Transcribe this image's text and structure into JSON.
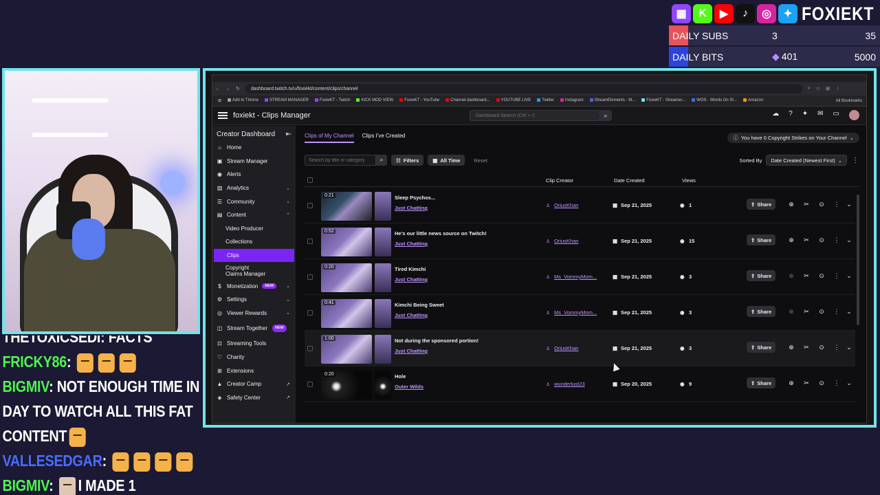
{
  "overlay": {
    "channel_brand": "FOXIEKT",
    "socials": [
      {
        "icon": "twitch-icon",
        "glyph": "▦",
        "color": "#9146ff"
      },
      {
        "icon": "kick-icon",
        "glyph": "K",
        "color": "#53fc18"
      },
      {
        "icon": "youtube-icon",
        "glyph": "▶",
        "color": "#ff0000"
      },
      {
        "icon": "tiktok-icon",
        "glyph": "♪",
        "color": "#111111"
      },
      {
        "icon": "instagram-icon",
        "glyph": "◎",
        "color": "#d6249f"
      },
      {
        "icon": "twitter-icon",
        "glyph": "✦",
        "color": "#1da1f2"
      }
    ],
    "goals": [
      {
        "label": "DAILY SUBS",
        "current": "3",
        "max": "35",
        "progress": 0.086,
        "color": "#e8525a"
      },
      {
        "label": "DAILY BITS",
        "current": "401",
        "max": "5000",
        "progress": 0.08,
        "color": "#2c44d9"
      }
    ]
  },
  "chat": [
    {
      "user": "THETOXICSEDI",
      "text": "FACTS",
      "color": "#ffffff",
      "emotes": 0,
      "cut": true
    },
    {
      "user": "FRICKY86",
      "text": "",
      "color": "#4ff24f",
      "emotes": 3
    },
    {
      "user": "BIGMIV",
      "text": "NOT ENOUGH TIME IN THE",
      "color": "#4ff24f",
      "emotes": 0
    },
    {
      "user": "",
      "text": "DAY TO WATCH ALL THIS FAT",
      "color": "#ffffff",
      "emotes": 0
    },
    {
      "user": "",
      "text": "CONTENT",
      "color": "#ffffff",
      "emotes": 1
    },
    {
      "user": "VALLESEDGAR",
      "text": "",
      "color": "#4a6cff",
      "emotes": 4
    },
    {
      "user": "BIGMIV",
      "text": "I MADE 1",
      "color": "#4ff24f",
      "emotes": 0,
      "face": true
    }
  ],
  "browser": {
    "url": "dashboard.twitch.tv/u/foxiekt/content/clips/channel",
    "bookmarks": [
      {
        "label": "Add to Throne",
        "color": "#a0a0a0"
      },
      {
        "label": "STREAM MANAGER",
        "color": "#9146ff"
      },
      {
        "label": "FoxieKT - Twitch",
        "color": "#9146ff"
      },
      {
        "label": "KICK MOD VIEW",
        "color": "#53fc18"
      },
      {
        "label": "FoxieKT - YouTube",
        "color": "#ff0000"
      },
      {
        "label": "Channel dashboard...",
        "color": "#ff0000"
      },
      {
        "label": "YOUTUBE LIVE",
        "color": "#ff0000"
      },
      {
        "label": "Twitter",
        "color": "#1da1f2"
      },
      {
        "label": "Instagram",
        "color": "#d6249f"
      },
      {
        "label": "StreamElements - M...",
        "color": "#4e5ff0"
      },
      {
        "label": "FoxieKT - Streamer...",
        "color": "#70e4e8"
      },
      {
        "label": "WOS - Words On St...",
        "color": "#3a6cf0"
      },
      {
        "label": "Amazon",
        "color": "#ff9900"
      }
    ],
    "all_bookmarks": "All Bookmarks"
  },
  "dashboard": {
    "page_title": "foxiekt - Clips Manager",
    "search_placeholder": "Dashboard Search (Ctrl + /)",
    "sidebar_title": "Creator Dashboard",
    "sidebar": [
      {
        "label": "Home",
        "icon": "home-icon",
        "glyph": "⌂"
      },
      {
        "label": "Stream Manager",
        "icon": "stream-manager-icon",
        "glyph": "▣"
      },
      {
        "label": "Alerts",
        "icon": "alerts-icon",
        "glyph": "◉"
      },
      {
        "label": "Analytics",
        "icon": "analytics-icon",
        "glyph": "▥",
        "chevron": "⌄"
      },
      {
        "label": "Community",
        "icon": "community-icon",
        "glyph": "☰",
        "chevron": "⌄"
      },
      {
        "label": "Content",
        "icon": "content-icon",
        "glyph": "▤",
        "chevron": "⌃"
      },
      {
        "label": "Video Producer",
        "sub": true
      },
      {
        "label": "Collections",
        "sub": true
      },
      {
        "label": "Clips",
        "sub": true,
        "active": true
      },
      {
        "label": "Copyright Claims Manager",
        "sub": true,
        "two": true
      },
      {
        "label": "Monetization",
        "icon": "monetization-icon",
        "glyph": "$",
        "chevron": "⌄",
        "badge": "NEW"
      },
      {
        "label": "Settings",
        "icon": "settings-icon",
        "glyph": "⚙",
        "chevron": "⌄"
      },
      {
        "label": "Viewer Rewards",
        "icon": "viewer-rewards-icon",
        "glyph": "◎",
        "chevron": "⌄"
      },
      {
        "label": "Stream Together",
        "icon": "stream-together-icon",
        "glyph": "◫",
        "two": true,
        "badge": "NEW"
      },
      {
        "label": "Streaming Tools",
        "icon": "streaming-tools-icon",
        "glyph": "⊡"
      },
      {
        "label": "Charity",
        "icon": "charity-icon",
        "glyph": "♡"
      },
      {
        "label": "Extensions",
        "icon": "extensions-icon",
        "glyph": "⊞"
      },
      {
        "label": "Creator Camp",
        "icon": "creator-camp-icon",
        "glyph": "▲",
        "ext": "↗"
      },
      {
        "label": "Safety Center",
        "icon": "safety-center-icon",
        "glyph": "◈",
        "ext": "↗"
      }
    ],
    "tabs": [
      "Clips of My Channel",
      "Clips I've Created"
    ],
    "strikes": "You have 0 Copyright Strikes on Your Channel",
    "clip_search_placeholder": "Search by title or category",
    "filters_label": "Filters",
    "all_time_label": "All Time",
    "reset_label": "Reset",
    "sorted_by_label": "Sorted By",
    "sort_value": "Date Created (Newest First)",
    "columns": {
      "creator": "Clip Creator",
      "date": "Date Created",
      "views": "Views"
    },
    "share_label": "Share",
    "clips": [
      {
        "duration": "0:21",
        "title": "Sleep Psychos...",
        "category": "Just Chatting",
        "creator": "OriusKhan",
        "date": "Sep 21, 2025",
        "views": "1",
        "thumb": "screen"
      },
      {
        "duration": "0:52",
        "title": "He's our little news source on Twitch!",
        "category": "Just Chatting",
        "creator": "OriusKhan",
        "date": "Sep 21, 2025",
        "views": "15",
        "thumb": "room"
      },
      {
        "duration": "0:20",
        "title": "Tired Kimchi",
        "category": "Just Chatting",
        "creator": "Ms_VommyMom...",
        "date": "Sep 21, 2025",
        "views": "3",
        "thumb": "room",
        "dim": true
      },
      {
        "duration": "0:41",
        "title": "Kimchi Being Sweet",
        "category": "Just Chatting",
        "creator": "Ms_VommyMom...",
        "date": "Sep 21, 2025",
        "views": "3",
        "thumb": "room",
        "dim": true
      },
      {
        "duration": "1:00",
        "title": "Not during the sponsored portion!",
        "category": "Just Chatting",
        "creator": "OriusKhan",
        "date": "Sep 21, 2025",
        "views": "3",
        "thumb": "room",
        "hover": true
      },
      {
        "duration": "0:20",
        "title": "Hole",
        "category": "Outer Wilds",
        "creator": "wunderlust23",
        "date": "Sep 20, 2025",
        "views": "9",
        "thumb": "dark"
      }
    ]
  }
}
